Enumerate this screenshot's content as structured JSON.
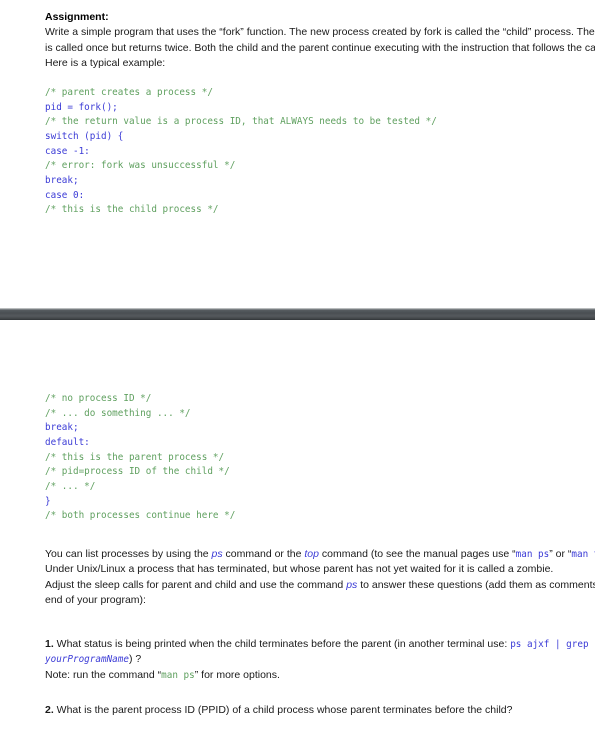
{
  "document": {
    "heading": "Assignment:",
    "intro_paragraph": "Write a simple program that uses the “fork” function. The new process created by fork is called the “child” process. The function is called once but returns twice. Both the child and the parent continue executing with the instruction that follows the call to fork. Here is a typical example:"
  },
  "code_block_1": {
    "lines": [
      {
        "text": "/* parent creates a process */",
        "style": "comment"
      },
      {
        "text": "pid = fork();",
        "style": "keyword"
      },
      {
        "text": "/* the return value is a process ID, that ALWAYS needs to be tested */",
        "style": "comment"
      },
      {
        "text": "switch (pid) {",
        "style": "keyword"
      },
      {
        "text": "case -1:",
        "style": "keyword"
      },
      {
        "text": "/* error: fork was unsuccessful */",
        "style": "comment"
      },
      {
        "text": "break;",
        "style": "keyword"
      },
      {
        "text": "case 0:",
        "style": "keyword"
      },
      {
        "text": "/* this is the child process */",
        "style": "comment"
      }
    ]
  },
  "code_block_2": {
    "lines": [
      {
        "text": "/* no process ID */",
        "style": "comment"
      },
      {
        "text": "/* ... do something ... */",
        "style": "comment"
      },
      {
        "text": "break;",
        "style": "keyword"
      },
      {
        "text": "default:",
        "style": "keyword"
      },
      {
        "text": "/* this is the parent process */",
        "style": "comment"
      },
      {
        "text": "/* pid=process ID of the child */",
        "style": "comment"
      },
      {
        "text": "/* ... */",
        "style": "comment"
      },
      {
        "text": "}",
        "style": "keyword"
      },
      {
        "text": "/* both processes continue here */",
        "style": "comment"
      }
    ]
  },
  "prose": {
    "p1_seg1": "You can list processes by using the ",
    "p1_ps": "ps",
    "p1_seg2": " command or the ",
    "p1_top": "top",
    "p1_seg3": " command (to see the manual pages use “",
    "p1_man_ps": "man ps",
    "p1_seg4": "” or “",
    "p1_man_top": "man top",
    "p1_seg5": "”). Under Unix/Linux a process that has terminated, but whose parent has not yet waited for it is called a zombie.",
    "p2_seg1": "Adjust the sleep calls for parent and child and use the command ",
    "p2_ps": "ps",
    "p2_seg2": " to answer these questions (add them as comments at the end of your program):"
  },
  "questions": [
    {
      "number": "1.",
      "text_before": " What status is being printed when the child terminates before the parent (in another terminal use: ",
      "cmd": "ps ajxf | grep ",
      "cmd_italic": "yourProgramName",
      "text_after": ") ?",
      "note_before": "Note: run the command “",
      "note_cmd": "man ps",
      "note_after": "” for more options."
    },
    {
      "number": "2.",
      "text": " What is the parent process ID (PPID) of a child process whose parent terminates before the child?"
    }
  ],
  "colors": {
    "comment_green": "#5fa05f",
    "keyword_blue": "#3b3bd6",
    "body_text": "#1a1a1a",
    "page_break_bar": "#4a4f53"
  }
}
